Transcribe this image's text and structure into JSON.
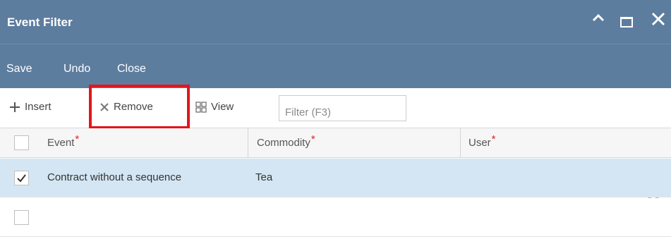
{
  "window": {
    "title": "Event Filter",
    "controls": {
      "minimize": "^",
      "close": "X"
    }
  },
  "menu": {
    "items": [
      "Save",
      "Undo",
      "Close"
    ]
  },
  "toolbar": {
    "insert_label": "Insert",
    "remove_label": "Remove",
    "view_label": "View",
    "filter_placeholder": "Filter (F3)"
  },
  "grid": {
    "columns": [
      {
        "label": "Event",
        "required_mark": "*"
      },
      {
        "label": "Commodity",
        "required_mark": "*"
      },
      {
        "label": "User",
        "required_mark": "*"
      }
    ],
    "rows": [
      {
        "checked": true,
        "event": "Contract without a sequence",
        "commodity": "Tea",
        "user": ""
      },
      {
        "checked": false,
        "event": "",
        "commodity": "",
        "user": ""
      }
    ]
  },
  "colors": {
    "header_bg": "#5d7d9f",
    "selected_row_bg": "#d4e6f3",
    "highlight_border": "#e3161b",
    "required_mark": "#e0201f"
  }
}
